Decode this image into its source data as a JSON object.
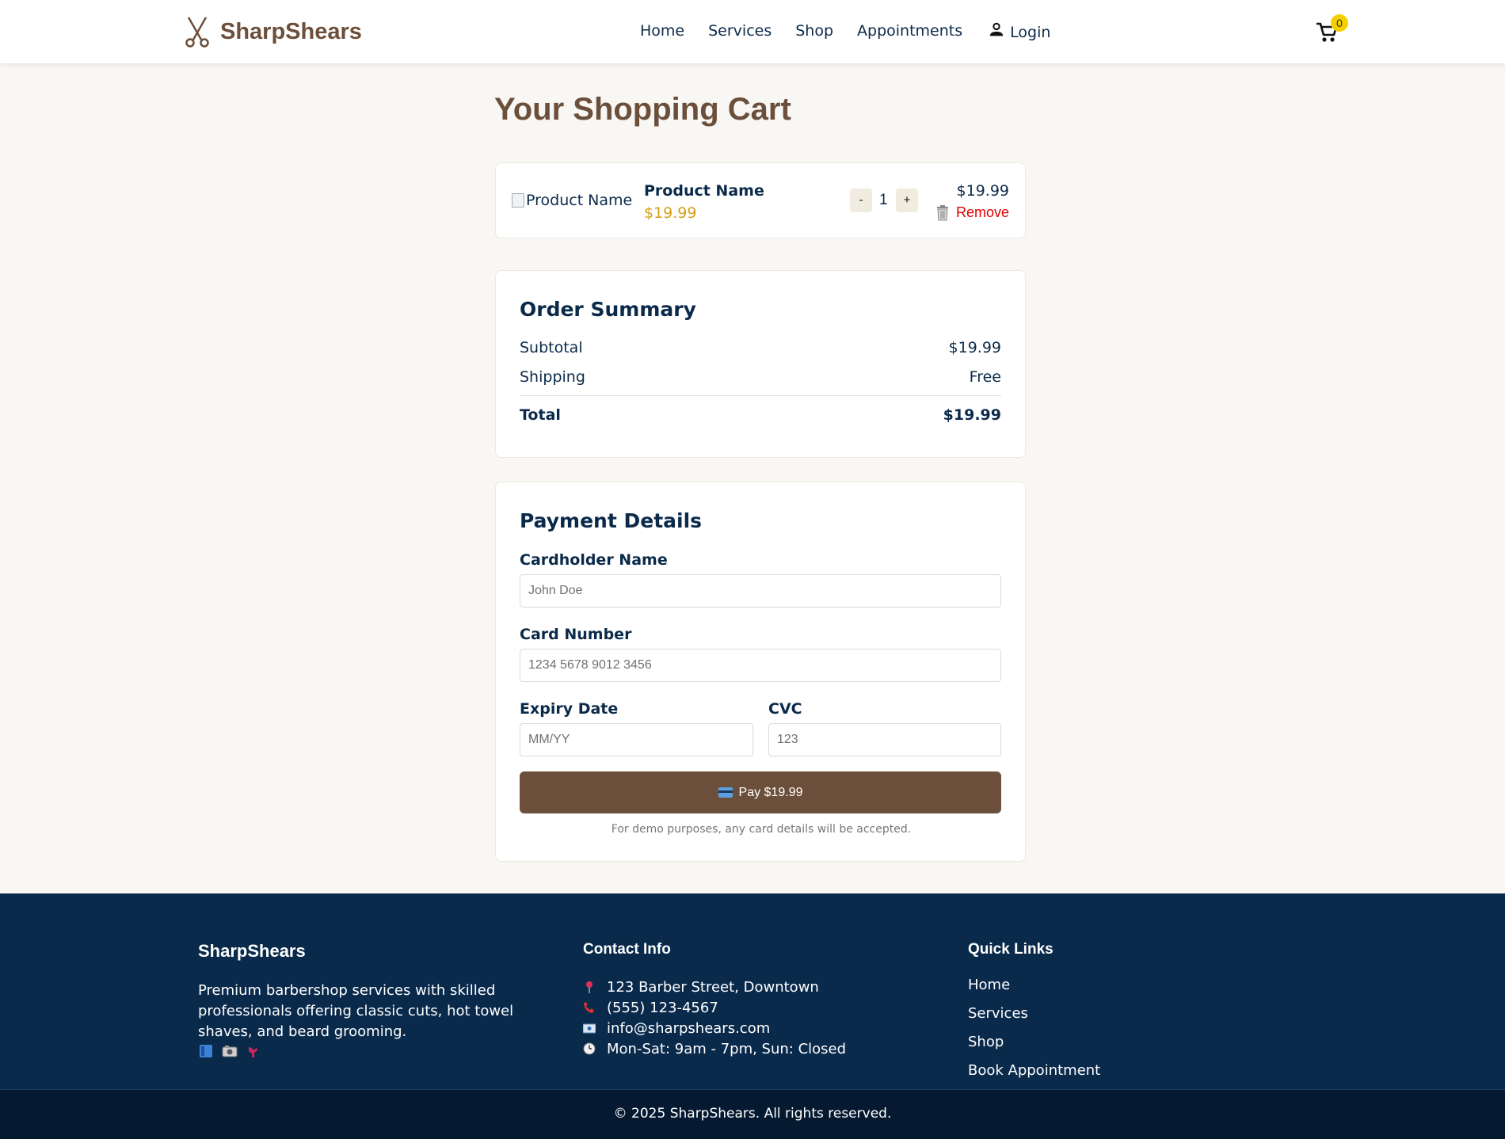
{
  "header": {
    "logo_text": "SharpShears",
    "nav": [
      "Home",
      "Services",
      "Shop",
      "Appointments"
    ],
    "login": "Login",
    "cart_count": "0"
  },
  "page_title": "Your Shopping Cart",
  "cart_item": {
    "image_alt": "Product Name",
    "name": "Product Name",
    "price": "$19.99",
    "minus": "-",
    "quantity": "1",
    "plus": "+",
    "line_total": "$19.99",
    "remove": "Remove"
  },
  "summary": {
    "title": "Order Summary",
    "subtotal_label": "Subtotal",
    "subtotal_value": "$19.99",
    "shipping_label": "Shipping",
    "shipping_value": "Free",
    "total_label": "Total",
    "total_value": "$19.99"
  },
  "payment": {
    "title": "Payment Details",
    "cardholder_label": "Cardholder Name",
    "cardholder_placeholder": "John Doe",
    "card_number_label": "Card Number",
    "card_number_placeholder": "1234 5678 9012 3456",
    "expiry_label": "Expiry Date",
    "expiry_placeholder": "MM/YY",
    "cvc_label": "CVC",
    "cvc_placeholder": "123",
    "pay_button": "Pay $19.99",
    "demo_note": "For demo purposes, any card details will be accepted."
  },
  "footer": {
    "brand": "SharpShears",
    "about": "Premium barbershop services with skilled professionals offering classic cuts, hot towel shaves, and beard grooming.",
    "social_icons": [
      "facebook-icon",
      "instagram-icon",
      "twitter-icon"
    ],
    "contact_title": "Contact Info",
    "address": "123 Barber Street, Downtown",
    "phone": "(555) 123-4567",
    "email": "info@sharpshears.com",
    "hours": "Mon-Sat: 9am - 7pm, Sun: Closed",
    "links_title": "Quick Links",
    "links": [
      "Home",
      "Services",
      "Shop",
      "Book Appointment"
    ],
    "copyright": "© 2025 SharpShears. All rights reserved."
  },
  "colors": {
    "brand_brown": "#6b4f3a",
    "navy": "#0a2a4c",
    "price_gold": "#d4a017",
    "remove_red": "#e00000",
    "badge_yellow": "#f5d000"
  }
}
